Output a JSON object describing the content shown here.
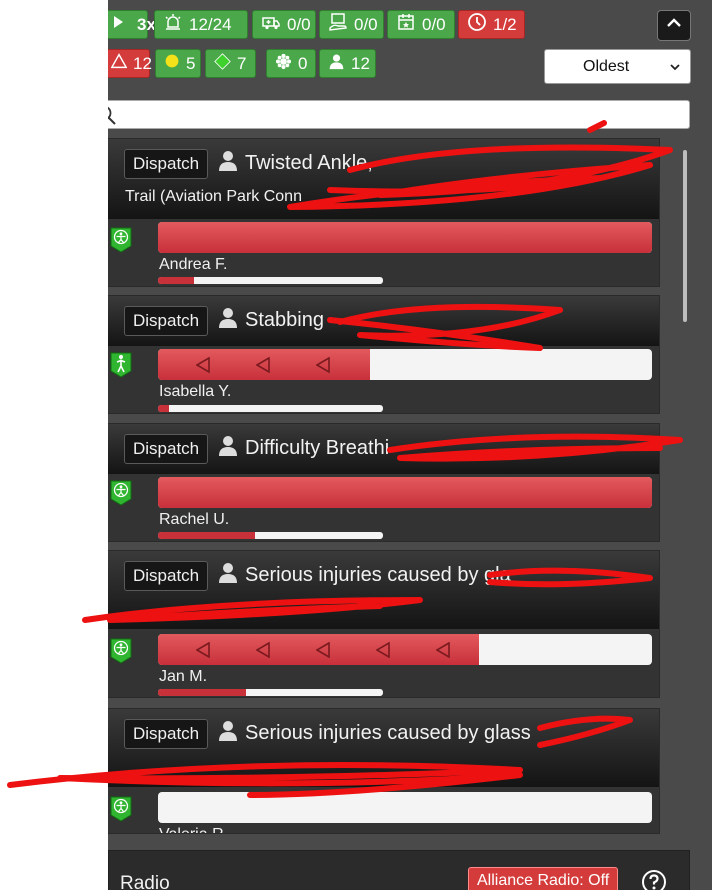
{
  "header": {
    "chips_row1": [
      {
        "label": "3x",
        "icon": "play-icon",
        "color": "green"
      },
      {
        "label": "12/24",
        "icon": "siren-icon",
        "color": "green"
      },
      {
        "label": "0/0",
        "icon": "ambulance-icon",
        "color": "green"
      },
      {
        "label": "0/0",
        "icon": "patient-transfer-icon",
        "color": "green"
      },
      {
        "label": "0/0",
        "icon": "calendar-event-icon",
        "color": "green"
      },
      {
        "label": "1/2",
        "icon": "clock-icon",
        "color": "red"
      }
    ],
    "chips_row2": [
      {
        "label": "12",
        "icon": "warning-triangle-icon",
        "color": "red"
      },
      {
        "label": "5",
        "icon": "yellow-circle-icon",
        "color": "green"
      },
      {
        "label": "7",
        "icon": "green-diamond-icon",
        "color": "green"
      },
      {
        "label": "0",
        "icon": "burst-icon",
        "color": "green"
      },
      {
        "label": "12",
        "icon": "person-icon",
        "color": "green"
      }
    ],
    "sort_value": "Oldest",
    "collapse_icon": "chevron-up-icon"
  },
  "search": {
    "placeholder": "",
    "icon": "search-icon"
  },
  "missions": [
    {
      "dispatch_label": "Dispatch",
      "title": "Twisted Ankle,",
      "title_line2": "Trail (Aviation Park Conn",
      "unit": "Andrea F.",
      "progress": 1.0,
      "arrows": 0,
      "mini_progress": 0.16,
      "badge_icon": "vitruvian-man-icon"
    },
    {
      "dispatch_label": "Dispatch",
      "title": "Stabbing",
      "title_line2": "",
      "unit": "Isabella Y.",
      "progress": 0.43,
      "arrows": 3,
      "mini_progress": 0.05,
      "badge_icon": "standing-man-icon"
    },
    {
      "dispatch_label": "Dispatch",
      "title": "Difficulty Breathi",
      "title_line2": "",
      "unit": "Rachel U.",
      "progress": 1.0,
      "arrows": 0,
      "mini_progress": 0.43,
      "badge_icon": "vitruvian-man-icon"
    },
    {
      "dispatch_label": "Dispatch",
      "title": "Serious injuries caused by gla",
      "title_line2": "",
      "unit": "Jan M.",
      "progress": 0.65,
      "arrows": 5,
      "mini_progress": 0.39,
      "badge_icon": "vitruvian-man-icon"
    },
    {
      "dispatch_label": "Dispatch",
      "title": "Serious injuries caused by glass",
      "title_line2": "",
      "unit": "Valeria R.",
      "progress": 0.0,
      "arrows": 0,
      "mini_progress": 0.0,
      "badge_icon": "vitruvian-man-icon"
    }
  ],
  "radio": {
    "label": "Radio",
    "alliance_button": "Alliance Radio: Off",
    "help_icon": "question-icon"
  }
}
